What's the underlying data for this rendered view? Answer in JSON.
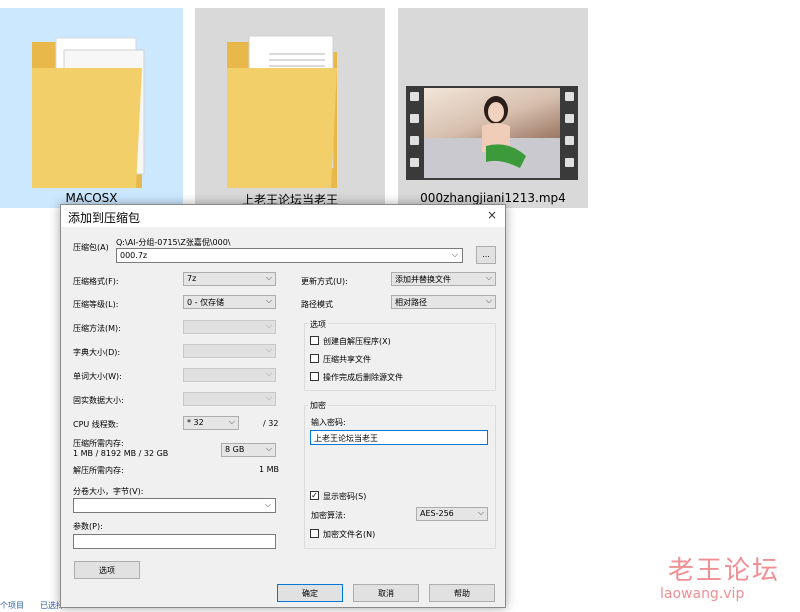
{
  "explorer": {
    "files": [
      {
        "name": "MACOSX",
        "type": "folder"
      },
      {
        "name": "上老王论坛当老王",
        "type": "folder"
      },
      {
        "name": "000zhangjiani1213.mp4",
        "type": "video"
      }
    ],
    "status_items": "个项目",
    "status_selected": "已选择"
  },
  "dialog": {
    "title": "添加到压缩包",
    "close_icon": "×",
    "archive_label": "压缩包(A)",
    "archive_path": "Q:\\AI-分组-0715\\Z张嘉倪\\000\\",
    "archive_name": "000.7z",
    "browse_label": "...",
    "format_label": "压缩格式(F):",
    "format_value": "7z",
    "level_label": "压缩等级(L):",
    "level_value": "0 - 仅存储",
    "method_label": "压缩方法(M):",
    "dict_label": "字典大小(D):",
    "word_label": "单词大小(W):",
    "solid_label": "固实数据大小:",
    "threads_label": "CPU 线程数:",
    "threads_value": "* 32",
    "threads_max": "/ 32",
    "mem_compress_label": "压缩所需内存:",
    "mem_compress_detail": "1 MB / 8192 MB / 32 GB",
    "mem_limit_value": "8 GB",
    "mem_decompress_label": "解压所需内存:",
    "mem_decompress_value": "1 MB",
    "split_label": "分卷大小，字节(V):",
    "split_value": "",
    "params_label": "参数(P):",
    "params_value": "",
    "options_button": "选项",
    "update_label": "更新方式(U):",
    "update_value": "添加并替换文件",
    "pathmode_label": "路径模式",
    "pathmode_value": "相对路径",
    "options_group": "选项",
    "opt_sfx": "创建自解压程序(X)",
    "opt_shared": "压缩共享文件",
    "opt_delete": "操作完成后删除源文件",
    "enc_group": "加密",
    "password_label": "输入密码:",
    "password_value": "上老王论坛当老王",
    "show_password": "显示密码(S)",
    "enc_method_label": "加密算法:",
    "enc_method_value": "AES-256",
    "enc_names": "加密文件名(N)",
    "ok_button": "确定",
    "cancel_button": "取消",
    "help_button": "帮助"
  },
  "watermark": {
    "text": "老王论坛",
    "url": "laowang.vip"
  }
}
